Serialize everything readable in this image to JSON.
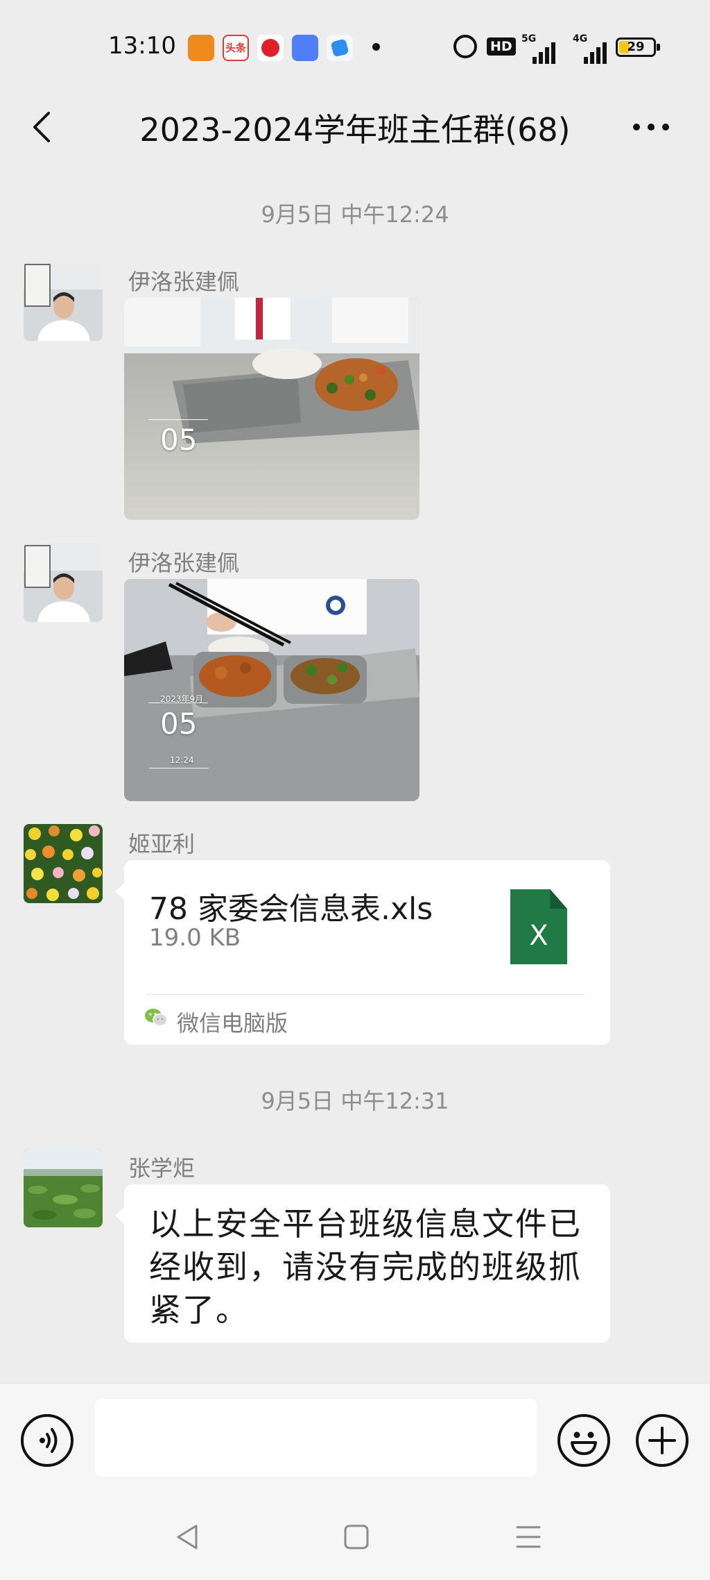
{
  "status_bar": {
    "time": "13:10",
    "notification_icons": [
      "app-icon-orange",
      "toutiao-app-icon",
      "video-app-icon",
      "message-app-icon",
      "feather-app-icon"
    ],
    "toutiao_label": "头条",
    "hd_label": "HD",
    "signal_1_label": "5G",
    "signal_2_label": "4G",
    "battery": "29",
    "battery_level": 0.29,
    "battery_color": "#f5c518"
  },
  "header": {
    "title": "2023-2024学年班主任群(68)"
  },
  "messages": {
    "timestamp_1": "9月5日 中午12:24",
    "msg1": {
      "sender": "伊洛张建佩",
      "photo_date": "05",
      "type": "image"
    },
    "msg2": {
      "sender": "伊洛张建佩",
      "photo_date": "05",
      "photo_month": "2023年9月",
      "photo_time": "12:24",
      "type": "image"
    },
    "msg3": {
      "sender": "姬亚利",
      "file_name": "78 家委会信息表.xls",
      "file_size": "19.0 KB",
      "file_icon_label": "X",
      "file_icon_color": "#1f7a45",
      "source": "微信电脑版",
      "type": "file"
    },
    "timestamp_2": "9月5日 中午12:31",
    "msg4": {
      "sender": "张学炬",
      "text": "以上安全平台班级信息文件已经收到，请没有完成的班级抓紧了。",
      "type": "text"
    }
  },
  "input_bar": {
    "value": "",
    "icons": [
      "voice-icon",
      "emoji-icon",
      "plus-icon"
    ]
  },
  "colors": {
    "background": "#ededed",
    "bubble": "#ffffff",
    "meta_text": "#8d8d8d"
  }
}
